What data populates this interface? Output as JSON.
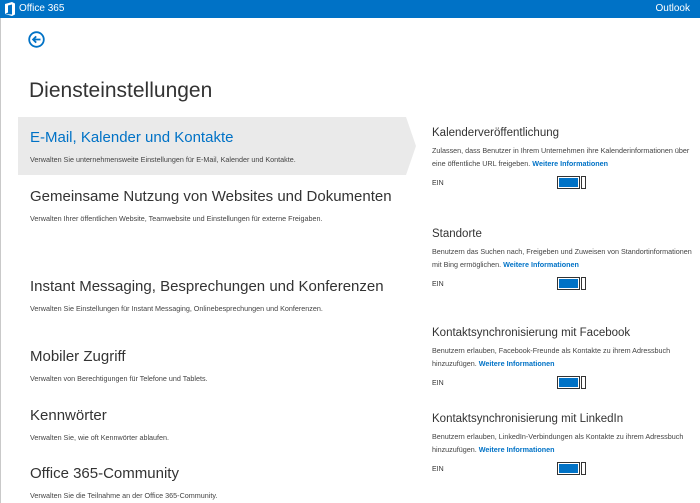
{
  "topbar": {
    "app_title": "Office 365",
    "outlook_link": "Outlook",
    "logo_icon": "office-logo-icon",
    "bg_color": "#0072c6"
  },
  "back_icon": "back-arrow-circle-icon",
  "page_title": "Diensteinstellungen",
  "categories": [
    {
      "title": "E-Mail, Kalender und Kontakte",
      "desc": "Verwalten Sie unternehmensweite Einstellungen für E-Mail, Kalender und Kontakte.",
      "selected": true
    },
    {
      "title": "Gemeinsame Nutzung von Websites und Dokumenten",
      "desc": "Verwalten Ihrer öffentlichen Website, Teamwebsite und Einstellungen für externe Freigaben."
    },
    {
      "title": "Instant Messaging, Besprechungen und Konferenzen",
      "desc": "Verwalten Sie Einstellungen für Instant Messaging, Onlinebesprechungen und Konferenzen."
    },
    {
      "title": "Mobiler Zugriff",
      "desc": "Verwalten von Berechtigungen für Telefone und Tablets."
    },
    {
      "title": "Kennwörter",
      "desc": "Verwalten Sie, wie oft Kennwörter ablaufen."
    },
    {
      "title": "Office 365-Community",
      "desc": "Verwalten Sie die Teilnahme an der Office 365-Community."
    }
  ],
  "settings": [
    {
      "title": "Kalenderveröffentlichung",
      "desc": "Zulassen, dass Benutzer in Ihrem Unternehmen ihre Kalenderinformationen über eine öffentliche URL freigeben.",
      "more": "Weitere Informationen",
      "state": "EIN",
      "on": true
    },
    {
      "title": "Standorte",
      "desc": "Benutzern das Suchen nach, Freigeben und Zuweisen von Standortinformationen mit Bing ermöglichen.",
      "more": "Weitere Informationen",
      "state": "EIN",
      "on": true
    },
    {
      "title": "Kontaktsynchronisierung mit Facebook",
      "desc": "Benutzern erlauben, Facebook-Freunde als Kontakte zu ihrem Adressbuch hinzuzufügen.",
      "more": "Weitere Informationen",
      "state": "EIN",
      "on": true
    },
    {
      "title": "Kontaktsynchronisierung mit LinkedIn",
      "desc": "Benutzern erlauben, LinkedIn-Verbindungen als Kontakte zu ihrem Adressbuch hinzuzufügen.",
      "more": "Weitere Informationen",
      "state": "EIN",
      "on": true
    }
  ],
  "colors": {
    "accent": "#0072c6",
    "selected_bg": "#eaeaea"
  }
}
